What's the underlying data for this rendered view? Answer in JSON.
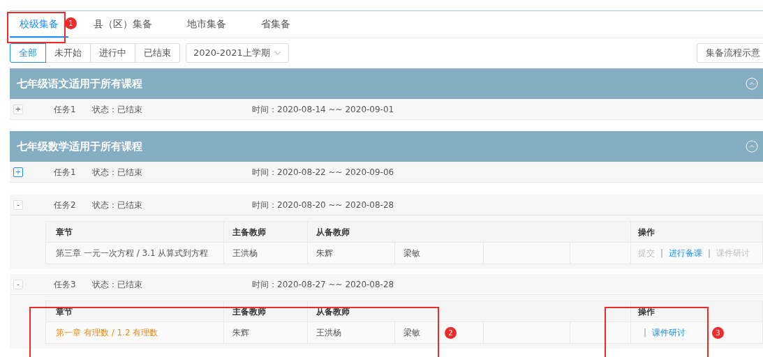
{
  "tabs": [
    {
      "label": "校级集备",
      "selected": true
    },
    {
      "label": "县（区）集备",
      "selected": false
    },
    {
      "label": "地市集备",
      "selected": false
    },
    {
      "label": "省集备",
      "selected": false
    }
  ],
  "status_filter": [
    {
      "label": "全部",
      "selected": true
    },
    {
      "label": "未开始",
      "selected": false
    },
    {
      "label": "进行中",
      "selected": false
    },
    {
      "label": "已结束",
      "selected": false
    }
  ],
  "term_select": {
    "value": "2020-2021上学期"
  },
  "flow_button": "集备流程示意",
  "groups": [
    {
      "title": "七年级语文适用于所有课程",
      "tasks": [
        {
          "name": "任务1",
          "status": "状态：已结束",
          "time": "时间：2020-08-14 ~~ 2020-09-01",
          "toggle": "+",
          "focused": false
        }
      ]
    },
    {
      "title": "七年级数学适用于所有课程",
      "tasks": [
        {
          "name": "任务1",
          "status": "状态：已结束",
          "time": "时间：2020-08-22 ~~ 2020-09-06",
          "toggle": "+",
          "focused": true
        },
        {
          "name": "任务2",
          "status": "状态：已结束",
          "time": "时间：2020-08-20 ~~ 2020-08-28",
          "toggle": "-",
          "focused": false,
          "table": {
            "columns": [
              "章节",
              "主备教师",
              "从备教师",
              "操作"
            ],
            "rows": [
              {
                "chapter": "第三章 一元一次方程 / 3.1 从算式到方程",
                "highlighted": false,
                "lead_teacher": "王洪杨",
                "assistants": [
                  "朱辉",
                  "梁敏"
                ],
                "actions": [
                  {
                    "kind": "link",
                    "label": "提交",
                    "disabled": true
                  },
                  {
                    "kind": "separator",
                    "label": "|"
                  },
                  {
                    "kind": "link",
                    "label": "进行备课",
                    "disabled": false
                  },
                  {
                    "kind": "separator",
                    "label": "|"
                  },
                  {
                    "kind": "link",
                    "label": "课件研讨",
                    "disabled": true
                  }
                ]
              }
            ]
          }
        },
        {
          "name": "任务3",
          "status": "状态：已结束",
          "time": "时间：2020-08-27 ~~ 2020-08-28",
          "toggle": "-",
          "focused": false,
          "table": {
            "columns": [
              "章节",
              "主备教师",
              "从备教师",
              "操作"
            ],
            "rows": [
              {
                "chapter": "第一章 有理数 / 1.2 有理数",
                "highlighted": true,
                "lead_teacher": "朱辉",
                "assistants": [
                  "王洪杨",
                  "梁敏"
                ],
                "actions": [
                  {
                    "kind": "separator",
                    "label": "|"
                  },
                  {
                    "kind": "link",
                    "label": "课件研讨",
                    "disabled": false
                  }
                ]
              }
            ]
          }
        }
      ]
    }
  ],
  "callouts": [
    {
      "number": "1"
    },
    {
      "number": "2"
    },
    {
      "number": "3"
    }
  ]
}
